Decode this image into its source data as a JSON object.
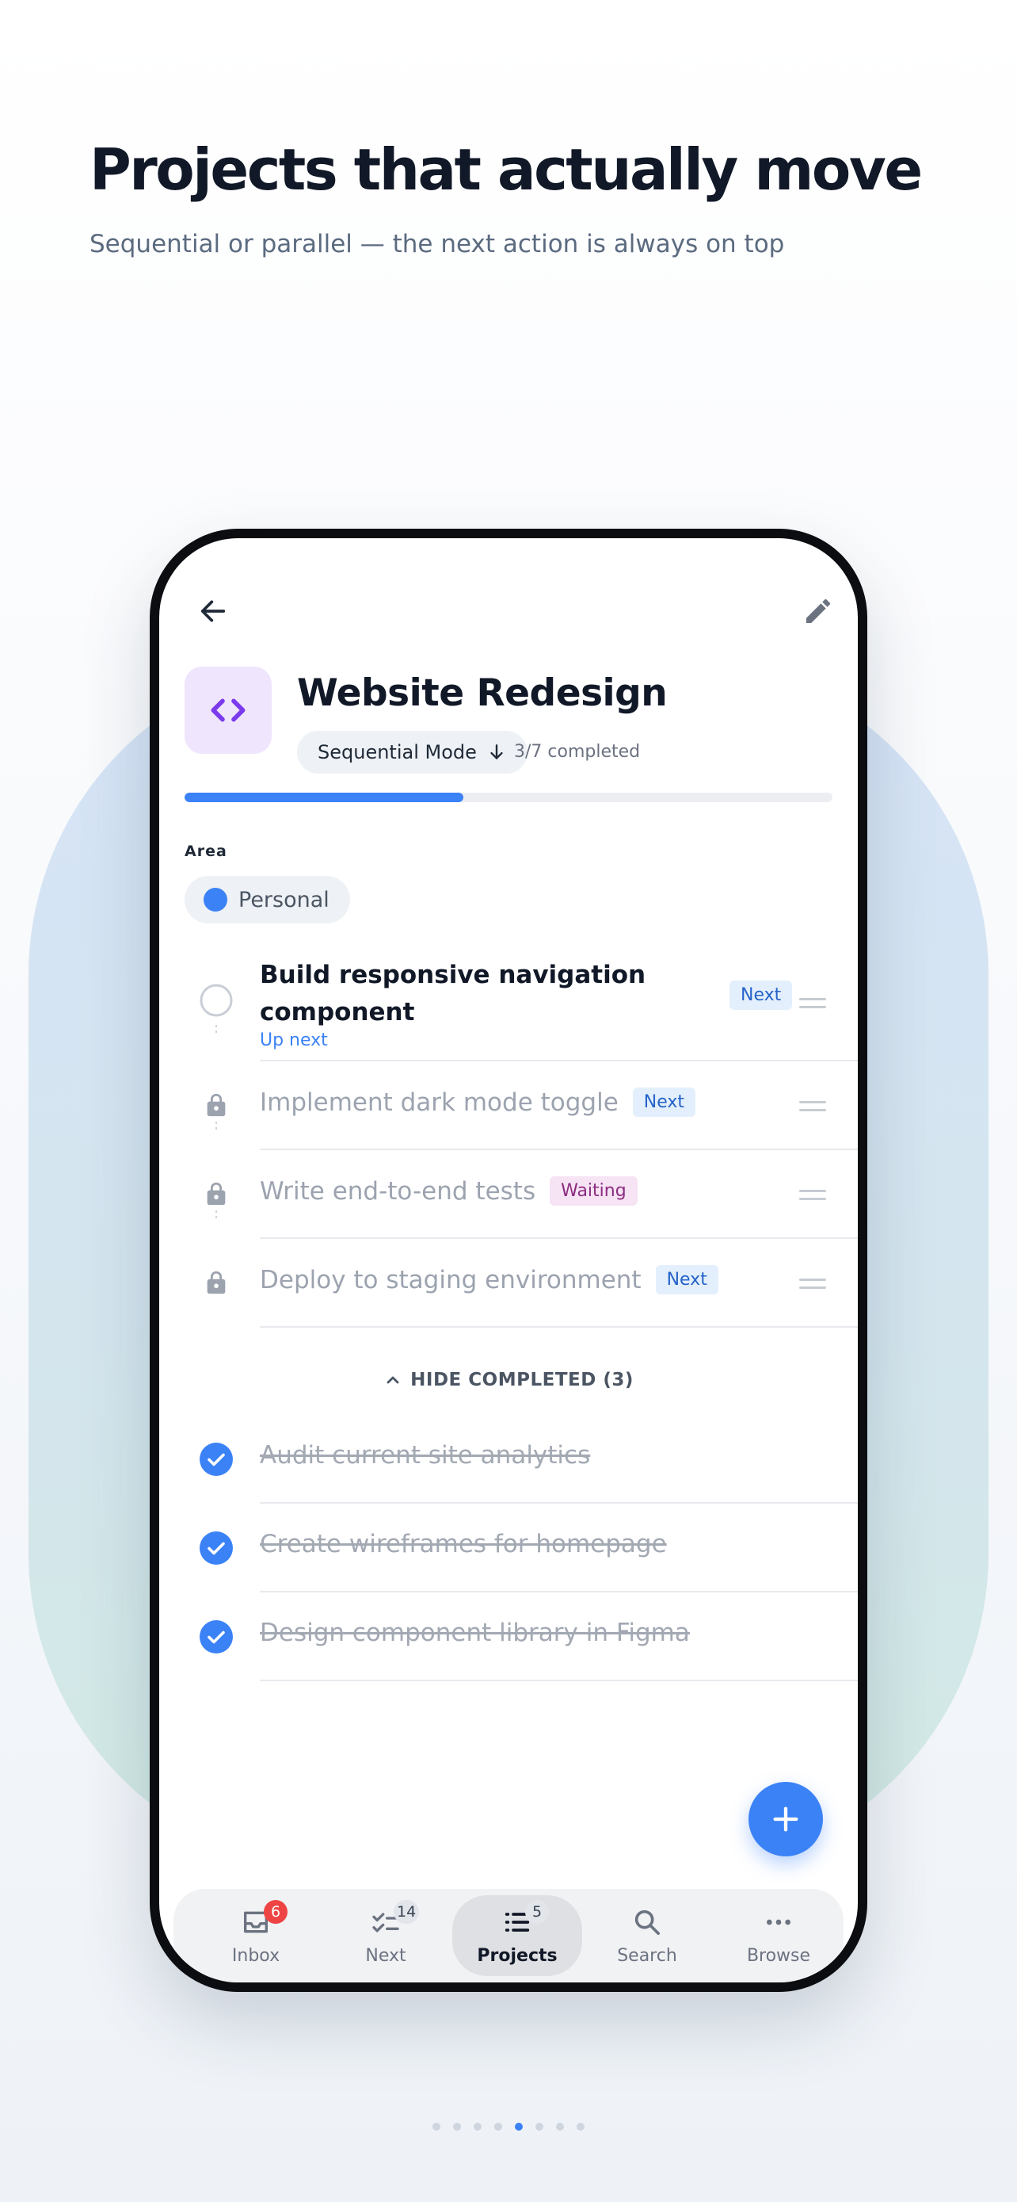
{
  "hero": {
    "headline": "Projects that actually move",
    "subhead": "Sequential or parallel — the next action is always on top"
  },
  "project": {
    "title": "Website Redesign",
    "icon": "code-brackets-icon",
    "mode_label": "Sequential Mode",
    "completed_text": "3/7 completed",
    "progress": 0.43,
    "area_label": "Area",
    "area_value": "Personal"
  },
  "tasks": [
    {
      "title": "Build responsive navigation component",
      "subtitle": "Up next",
      "badge": "Next",
      "status": "open"
    },
    {
      "title": "Implement dark mode toggle",
      "badge": "Next",
      "status": "locked"
    },
    {
      "title": "Write end-to-end tests",
      "badge": "Waiting",
      "status": "locked"
    },
    {
      "title": "Deploy to staging environment",
      "badge": "Next",
      "status": "locked"
    }
  ],
  "hide_completed_label": "HIDE COMPLETED (3)",
  "completed_tasks": [
    {
      "title": "Audit current site analytics"
    },
    {
      "title": "Create wireframes for homepage"
    },
    {
      "title": "Design component library in Figma"
    }
  ],
  "tabbar": [
    {
      "label": "Inbox",
      "badge": "6",
      "icon": "inbox-icon"
    },
    {
      "label": "Next",
      "badge": "14",
      "icon": "checklist-icon"
    },
    {
      "label": "Projects",
      "badge": "5",
      "icon": "list-icon",
      "active": true
    },
    {
      "label": "Search",
      "icon": "search-icon"
    },
    {
      "label": "Browse",
      "icon": "more-dots-icon"
    }
  ],
  "pager": {
    "count": 8,
    "active_index": 4
  },
  "colors": {
    "accent": "#3b82f6",
    "project_icon_bg": "#efe6fd",
    "project_icon_fg": "#7c3aed",
    "badge_next_bg": "#e3effc",
    "badge_waiting_bg": "#f6e3f4",
    "badge_red": "#ef4444"
  }
}
